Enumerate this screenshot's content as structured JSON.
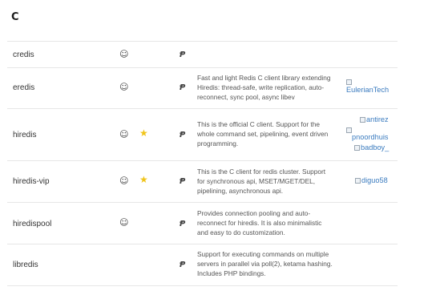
{
  "section": {
    "title": "C"
  },
  "rows": [
    {
      "name": "credis",
      "smile": "☺",
      "star": "",
      "repo": "Ᵽ",
      "description": [],
      "authors": []
    },
    {
      "name": "eredis",
      "smile": "☺",
      "star": "",
      "repo": "Ᵽ",
      "description": [
        "Fast and light Redis C client library extending",
        "Hiredis: thread-safe, write replication, auto-",
        "reconnect, sync pool, async libev"
      ],
      "authors": [
        "EulerianTech"
      ]
    },
    {
      "name": "hiredis",
      "smile": "☺",
      "star": "★",
      "repo": "Ᵽ",
      "description": [
        "This is the official C client. Support for the",
        "whole command set, pipelining, event driven",
        "programming."
      ],
      "authors": [
        "antirez",
        "pnoordhuis",
        "badboy_"
      ]
    },
    {
      "name": "hiredis-vip",
      "smile": "☺",
      "star": "★",
      "repo": "Ᵽ",
      "description": [
        "This is the C client for redis cluster. Support",
        "for synchronous api, MSET/MGET/DEL,",
        "pipelining, asynchronous api."
      ],
      "authors": [
        "diguo58"
      ]
    },
    {
      "name": "hiredispool",
      "smile": "☺",
      "star": "",
      "repo": "Ᵽ",
      "description": [
        "Provides connection pooling and auto-",
        "reconnect for hiredis. It is also minimalistic",
        "and easy to do customization."
      ],
      "authors": []
    },
    {
      "name": "libredis",
      "smile": "",
      "star": "",
      "repo": "Ᵽ",
      "description": [
        "Support for executing commands on multiple",
        "servers in parallel via poll(2), ketama hashing.",
        "Includes PHP bindings."
      ],
      "authors": []
    }
  ]
}
